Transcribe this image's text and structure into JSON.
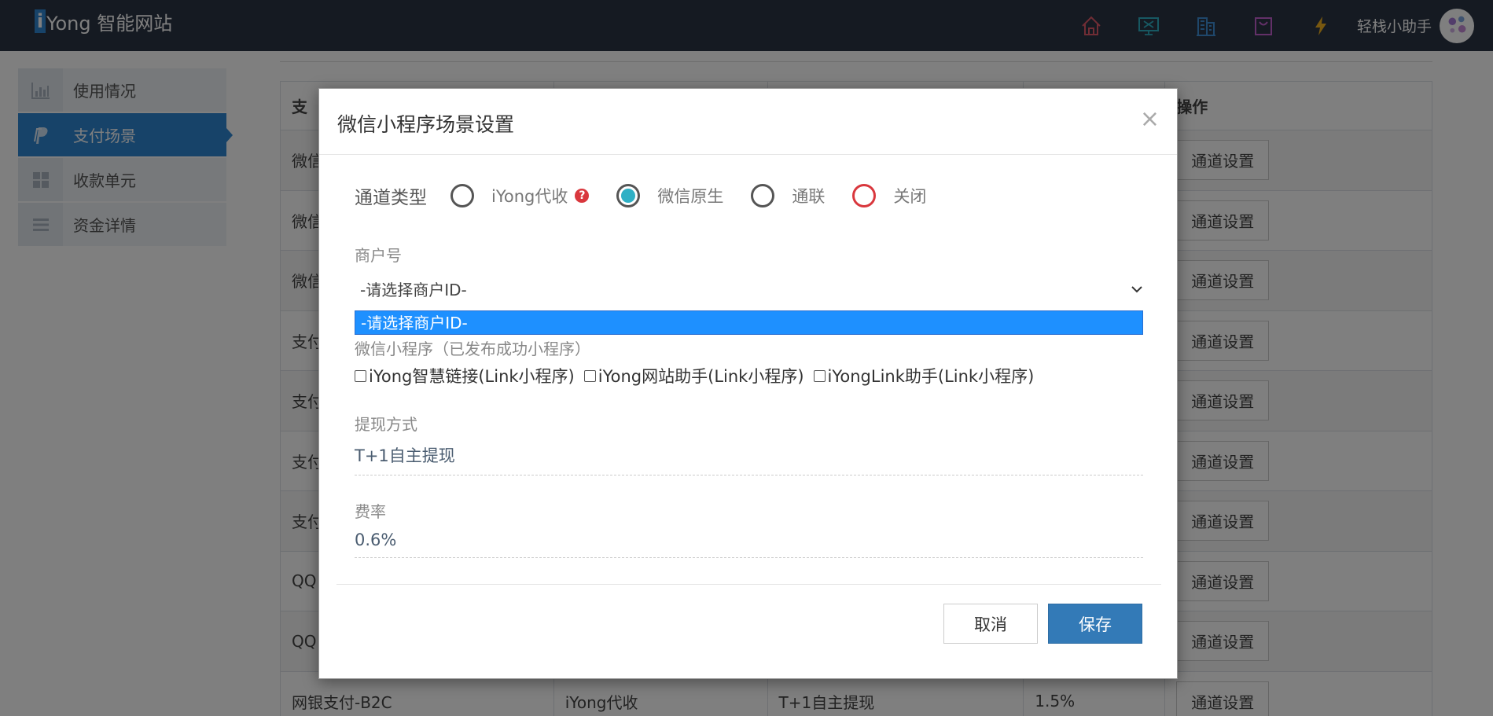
{
  "app": {
    "logo_letter": "i",
    "logo_text": "Yong 智能网站",
    "username": "轻栈小助手"
  },
  "topbar": {
    "icons": [
      {
        "name": "home-icon",
        "color": "#e05a6a"
      },
      {
        "name": "monitor-icon",
        "color": "#2fb0c5"
      },
      {
        "name": "building-icon",
        "color": "#3f8fd6"
      },
      {
        "name": "shopping-bag-icon",
        "color": "#c560d0"
      },
      {
        "name": "lightning-icon",
        "color": "#f0b020"
      }
    ]
  },
  "sidebar": {
    "items": [
      {
        "label": "使用情况",
        "icon": "chart-icon",
        "active": false
      },
      {
        "label": "支付场景",
        "icon": "paypal-icon",
        "active": true
      },
      {
        "label": "收款单元",
        "icon": "grid-icon",
        "active": false
      },
      {
        "label": "资金详情",
        "icon": "list-icon",
        "active": false
      }
    ]
  },
  "table": {
    "headers": [
      "支",
      "",
      "",
      "",
      "操作"
    ],
    "rows": [
      [
        "微信",
        "",
        "",
        "",
        "通道设置"
      ],
      [
        "微信",
        "",
        "",
        "",
        "通道设置"
      ],
      [
        "微信",
        "",
        "",
        "",
        "通道设置"
      ],
      [
        "支付",
        "",
        "",
        "",
        "通道设置"
      ],
      [
        "支付",
        "",
        "",
        "",
        "通道设置"
      ],
      [
        "支付",
        "",
        "",
        "",
        "通道设置"
      ],
      [
        "支付",
        "",
        "",
        "",
        "通道设置"
      ],
      [
        "QQ",
        "",
        "",
        "",
        "通道设置"
      ],
      [
        "QQ",
        "",
        "",
        "",
        "通道设置"
      ],
      [
        "网银支付-B2C",
        "iYong代收",
        "T+1自主提现",
        "1.5%",
        "通道设置"
      ]
    ]
  },
  "modal": {
    "title": "微信小程序场景设置",
    "close": "×",
    "channel_label": "通道类型",
    "channel_options": [
      {
        "label": "iYong代收",
        "checked": false,
        "help": "?"
      },
      {
        "label": "微信原生",
        "checked": true
      },
      {
        "label": "通联",
        "checked": false
      },
      {
        "label": "关闭",
        "checked": false
      }
    ],
    "merchant_label": "商户号",
    "merchant_value": "-请选择商户ID-",
    "merchant_option": "-请选择商户ID-",
    "mini_label": "微信小程序（已发布成功小程序）",
    "mini_programs": [
      "iYong智慧链接(Link小程序)",
      "iYong网站助手(Link小程序)",
      "iYongLink助手(Link小程序)"
    ],
    "withdraw_label": "提现方式",
    "withdraw_value": "T+1自主提现",
    "fee_label": "费率",
    "fee_value": "0.6%",
    "cancel_label": "取消",
    "save_label": "保存"
  }
}
